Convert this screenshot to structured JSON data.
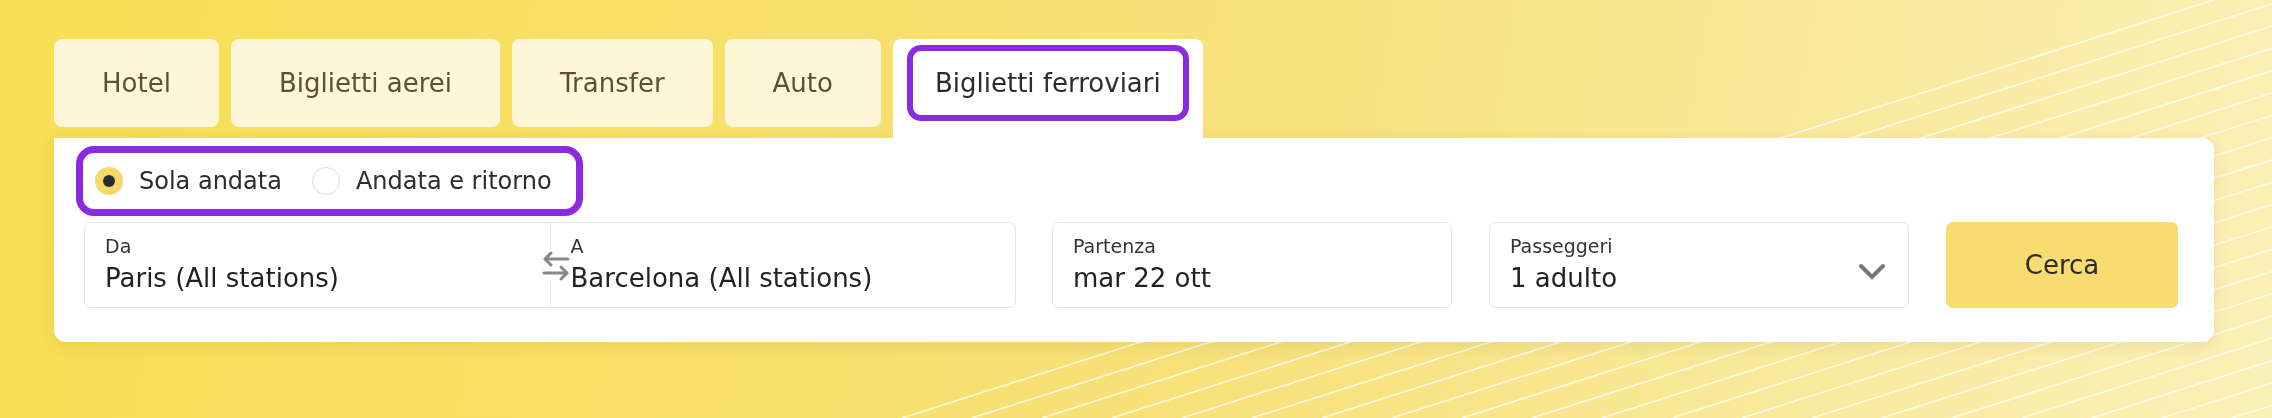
{
  "tabs": [
    {
      "label": "Hotel",
      "selected": false
    },
    {
      "label": "Biglietti aerei",
      "selected": false
    },
    {
      "label": "Transfer",
      "selected": false
    },
    {
      "label": "Auto",
      "selected": false
    },
    {
      "label": "Biglietti ferroviari",
      "selected": true
    }
  ],
  "trip_type": {
    "outlined": true,
    "options": [
      {
        "label": "Sola andata",
        "selected": true
      },
      {
        "label": "Andata e ritorno",
        "selected": false
      }
    ]
  },
  "route": {
    "from": {
      "label": "Da",
      "value": "Paris (All stations)"
    },
    "to": {
      "label": "A",
      "value": "Barcelona (All stations)"
    }
  },
  "departure": {
    "label": "Partenza",
    "value": "mar 22 ott"
  },
  "passengers": {
    "label": "Passeggeri",
    "value": "1 adulto"
  },
  "search_button": "Cerca"
}
